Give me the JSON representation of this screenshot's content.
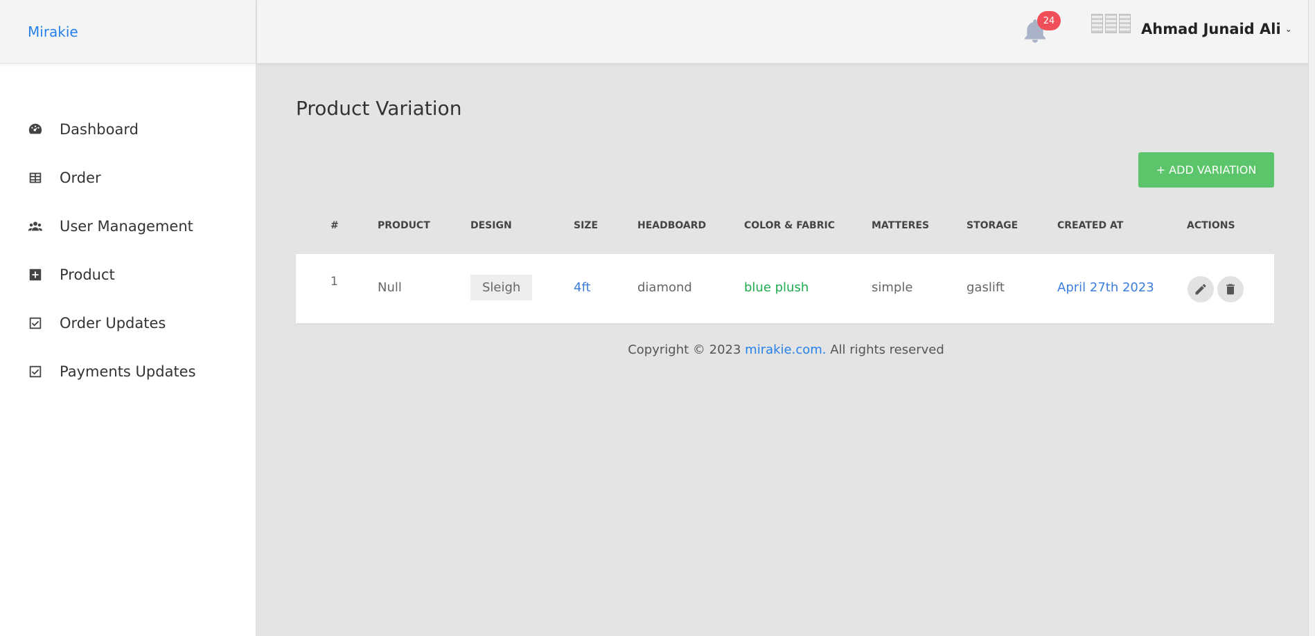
{
  "brand": "Mirakie",
  "nav": [
    {
      "label": "Dashboard",
      "icon": "dashboard-icon"
    },
    {
      "label": "Order",
      "icon": "table-icon"
    },
    {
      "label": "User Management",
      "icon": "users-icon"
    },
    {
      "label": "Product",
      "icon": "plus-square-icon"
    },
    {
      "label": "Order Updates",
      "icon": "check-square-icon"
    },
    {
      "label": "Payments Updates",
      "icon": "check-square-icon"
    }
  ],
  "topbar": {
    "notification_count": "24",
    "user_name": "Ahmad Junaid Ali"
  },
  "page": {
    "title": "Product Variation",
    "add_button": "+ ADD VARIATION"
  },
  "table": {
    "headers": [
      "#",
      "PRODUCT",
      "DESIGN",
      "SIZE",
      "HEADBOARD",
      "COLOR & FABRIC",
      "MATTERES",
      "STORAGE",
      "CREATED AT",
      "ACTIONS"
    ],
    "rows": [
      {
        "index": "1",
        "product": "Null",
        "design": "Sleigh",
        "size": "4ft",
        "headboard": "diamond",
        "color_fabric": "blue plush",
        "matteres": "simple",
        "storage": "gaslift",
        "created_at": "April 27th 2023"
      }
    ]
  },
  "footer": {
    "prefix": "Copyright © 2023 ",
    "link": "mirakie.com.",
    "suffix": " All rights reserved"
  },
  "colors": {
    "accent": "#2680eb",
    "add_button": "#5cc56b",
    "badge": "#f04f5a",
    "color_fabric_text": "#20ab4f",
    "link_text": "#3b7ddd"
  }
}
